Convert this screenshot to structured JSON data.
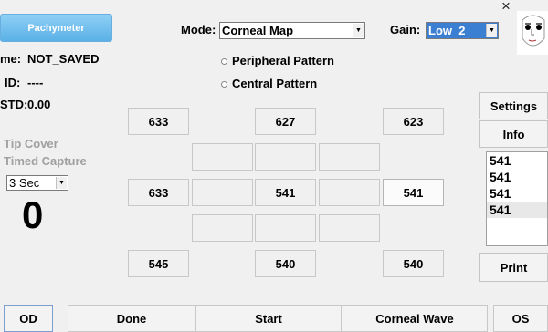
{
  "pachymeter_button": "Pachymeter",
  "mode": {
    "label": "Mode:",
    "value": "Corneal Map"
  },
  "gain": {
    "label": "Gain:",
    "value": "Low_2"
  },
  "close_glyph": "×",
  "patient": {
    "name_label": "me:",
    "name_value": "NOT_SAVED",
    "id_label": "ID:",
    "id_value": "----",
    "std_label": "STD:",
    "std_value": "0.00"
  },
  "patterns": {
    "peripheral": "Peripheral Pattern",
    "central": "Central Pattern"
  },
  "options": {
    "tip_cover": "Tip Cover",
    "timed_capture": "Timed Capture"
  },
  "capture_delay": "3 Sec",
  "count": "0",
  "grid": {
    "r1": [
      "633",
      "627",
      "623"
    ],
    "r3": {
      "left": "633",
      "center": "541",
      "right": "541"
    },
    "r5": [
      "545",
      "540",
      "540"
    ]
  },
  "right_panel": {
    "settings": "Settings",
    "info": "Info",
    "print": "Print"
  },
  "readings": [
    "541",
    "541",
    "541",
    "541"
  ],
  "bottom": {
    "od": "OD",
    "done": "Done",
    "start": "Start",
    "corneal_wave": "Corneal Wave",
    "os": "OS"
  }
}
